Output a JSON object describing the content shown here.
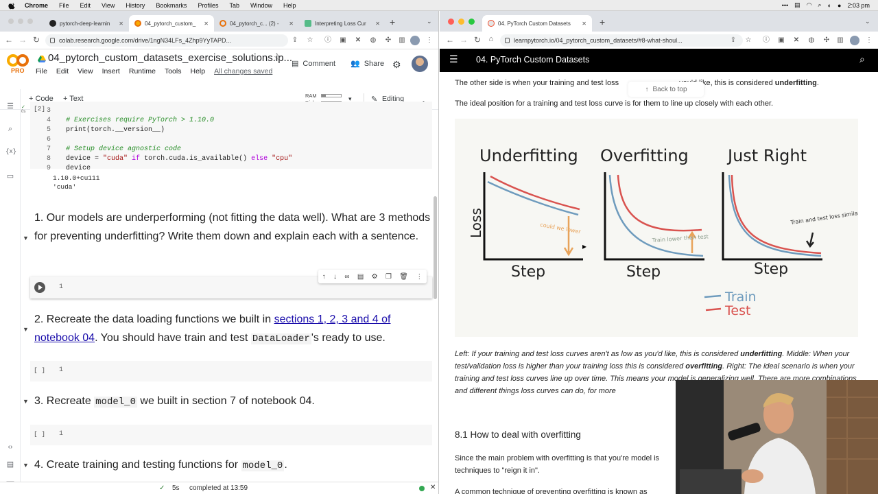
{
  "menubar": {
    "items": [
      "Chrome",
      "File",
      "Edit",
      "View",
      "History",
      "Bookmarks",
      "Profiles",
      "Tab",
      "Window",
      "Help"
    ],
    "clock": "2:03 pm"
  },
  "left_browser": {
    "tabs": [
      {
        "label": "pytorch-deep-learnin",
        "icon": "github-icon"
      },
      {
        "label": "04_pytorch_custom_",
        "icon": "colab-icon"
      },
      {
        "label": "04_pytorch_c... (2) -",
        "icon": "loading-icon"
      },
      {
        "label": "Interpreting Loss Cur",
        "icon": "code-icon"
      }
    ],
    "url": "colab.research.google.com/drive/1ngN34LFs_4Zhp9YyTAPD..."
  },
  "colab": {
    "logo": "CO",
    "pro": "PRO",
    "title": "04_pytorch_custom_datasets_exercise_solutions.ip...",
    "menu": [
      "File",
      "Edit",
      "View",
      "Insert",
      "Runtime",
      "Tools",
      "Help",
      "All changes saved"
    ],
    "comment": "Comment",
    "share": "Share",
    "add_code": "+ Code",
    "add_text": "+ Text",
    "ram": "RAM",
    "disk": "Disk",
    "ram_level": 0.2,
    "disk_level": 0.1,
    "editing": "Editing",
    "cell2": {
      "exec_count": "[2]",
      "exec_time": "0s",
      "lines": [
        {
          "n": "3",
          "code": ""
        },
        {
          "n": "4",
          "code": "# Exercises require PyTorch > 1.10.0"
        },
        {
          "n": "5",
          "code": "print(torch.__version__)"
        },
        {
          "n": "6",
          "code": ""
        },
        {
          "n": "7",
          "code": "# Setup device agnostic code"
        },
        {
          "n": "8",
          "code": "device = \"cuda\" if torch.cuda.is_available() else \"cpu\""
        },
        {
          "n": "9",
          "code": "device"
        }
      ],
      "output": [
        "1.10.0+cu111",
        "'cuda'"
      ]
    },
    "q1": "1. Our models are underperforming (not fitting the data well). What are 3 methods for preventing underfitting? Write them down and explain each with a sentence.",
    "q2_a": "2. Recreate the data loading functions we built in ",
    "q2_link": "sections 1, 2, 3 and 4 of notebook 04",
    "q2_b": ". You should have train and test ",
    "q2_code": "DataLoader",
    "q2_c": "'s ready to use.",
    "q3_a": "3. Recreate ",
    "q3_code": "model_0",
    "q3_b": " we built in section 7 of notebook 04.",
    "q4_a": "4. Create training and testing functions for ",
    "q4_code": "model_0",
    "q4_b": ".",
    "empty_cell_bracket": "[ ]",
    "line_one": "1",
    "status_time": "5s",
    "status_text": "completed at 13:59"
  },
  "right_browser": {
    "tab": "04. PyTorch Custom Datasets",
    "url": "learnpytorch.io/04_pytorch_custom_datasets/#8-what-shoul...",
    "header": "04. PyTorch Custom Datasets",
    "p1_a": "The other side is when your training and test loss",
    "p1_b": "you'd like, this is considered ",
    "p1_bold": "underfitting",
    "p1_end": ".",
    "back_to_top": "Back to top",
    "p2": "The ideal position for a training and test loss curve is for them to line up closely with each other.",
    "figure": {
      "titles": [
        "Underfitting",
        "Overfitting",
        "Just Right"
      ],
      "ylabel": "Loss",
      "xlabel": "Step",
      "notes": [
        "could we lower",
        "Train lower than test",
        "Train and test loss similar"
      ],
      "legend": [
        "Train",
        "Test"
      ],
      "train_color": "#6e9bbd",
      "test_color": "#d9534f",
      "note_color": "#e8a35a"
    },
    "caption": {
      "left": "Left: If your training and test loss curves aren't as low as you'd like, this is considered ",
      "left_bold": "underfitting",
      "middle": ". Middle: When your test/validation loss is higher than your training loss this is considered ",
      "middle_bold": "overfitting",
      "right": ". Right: The ideal scenario is when your training and test loss curves line up over time. This means your model is generalizing well. There are more combinations and different things loss curves can do, for more"
    },
    "section": "8.1 How to deal with overfitting",
    "p3": "Since the main problem with overfitting is that you're model is",
    "p3b": "techniques to \"reign it in\".",
    "p4": "A common technique of preventing overfitting is known as"
  }
}
